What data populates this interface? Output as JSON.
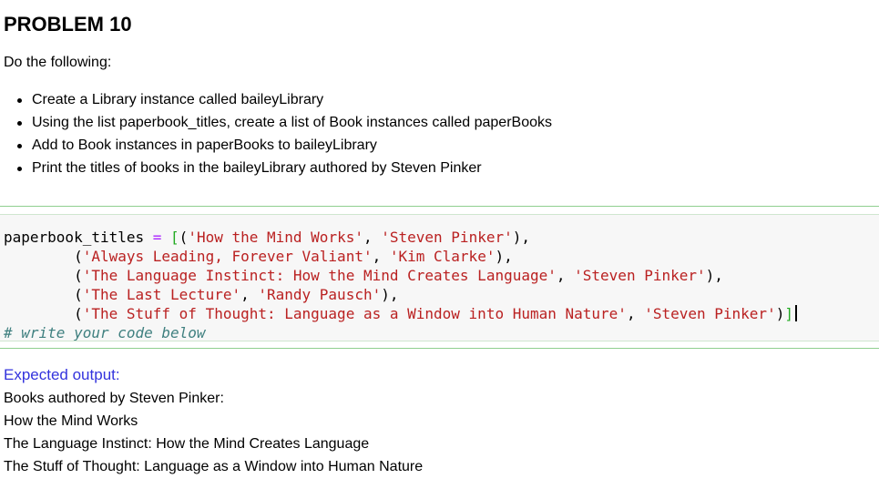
{
  "problem": {
    "title": "PROBLEM 10",
    "intro": "Do the following:",
    "tasks": [
      "Create a Library instance called baileyLibrary",
      "Using the list paperbook_titles, create a list of Book instances called paperBooks",
      "Add to Book instances in paperBooks to baileyLibrary",
      "Print the titles of books in the baileyLibrary authored by Steven Pinker"
    ]
  },
  "code": {
    "var_name": "paperbook_titles",
    "assign": " = ",
    "open_list": "[",
    "entries": [
      {
        "title": "'How the Mind Works'",
        "author": "'Steven Pinker'"
      },
      {
        "title": "'Always Leading, Forever Valiant'",
        "author": "'Kim Clarke'"
      },
      {
        "title": "'The Language Instinct: How the Mind Creates Language'",
        "author": "'Steven Pinker'"
      },
      {
        "title": "'The Last Lecture'",
        "author": "'Randy Pausch'"
      },
      {
        "title": "'The Stuff of Thought: Language as a Window into Human Nature'",
        "author": "'Steven Pinker'"
      }
    ],
    "close_list": "]",
    "comment": "# write your code below"
  },
  "expected": {
    "label": "Expected output:",
    "lines": [
      "Books authored by Steven Pinker:",
      "How the Mind Works",
      "The Language Instinct: How the Mind Creates Language",
      "The Stuff of Thought: Language as a Window into Human Nature"
    ]
  },
  "colors": {
    "string": "#ba2121",
    "operator": "#aa22ff",
    "comment": "#408080",
    "expected_label": "#3333dd",
    "cell_border": "#8fcf8f",
    "code_background": "#f7f7f7"
  }
}
